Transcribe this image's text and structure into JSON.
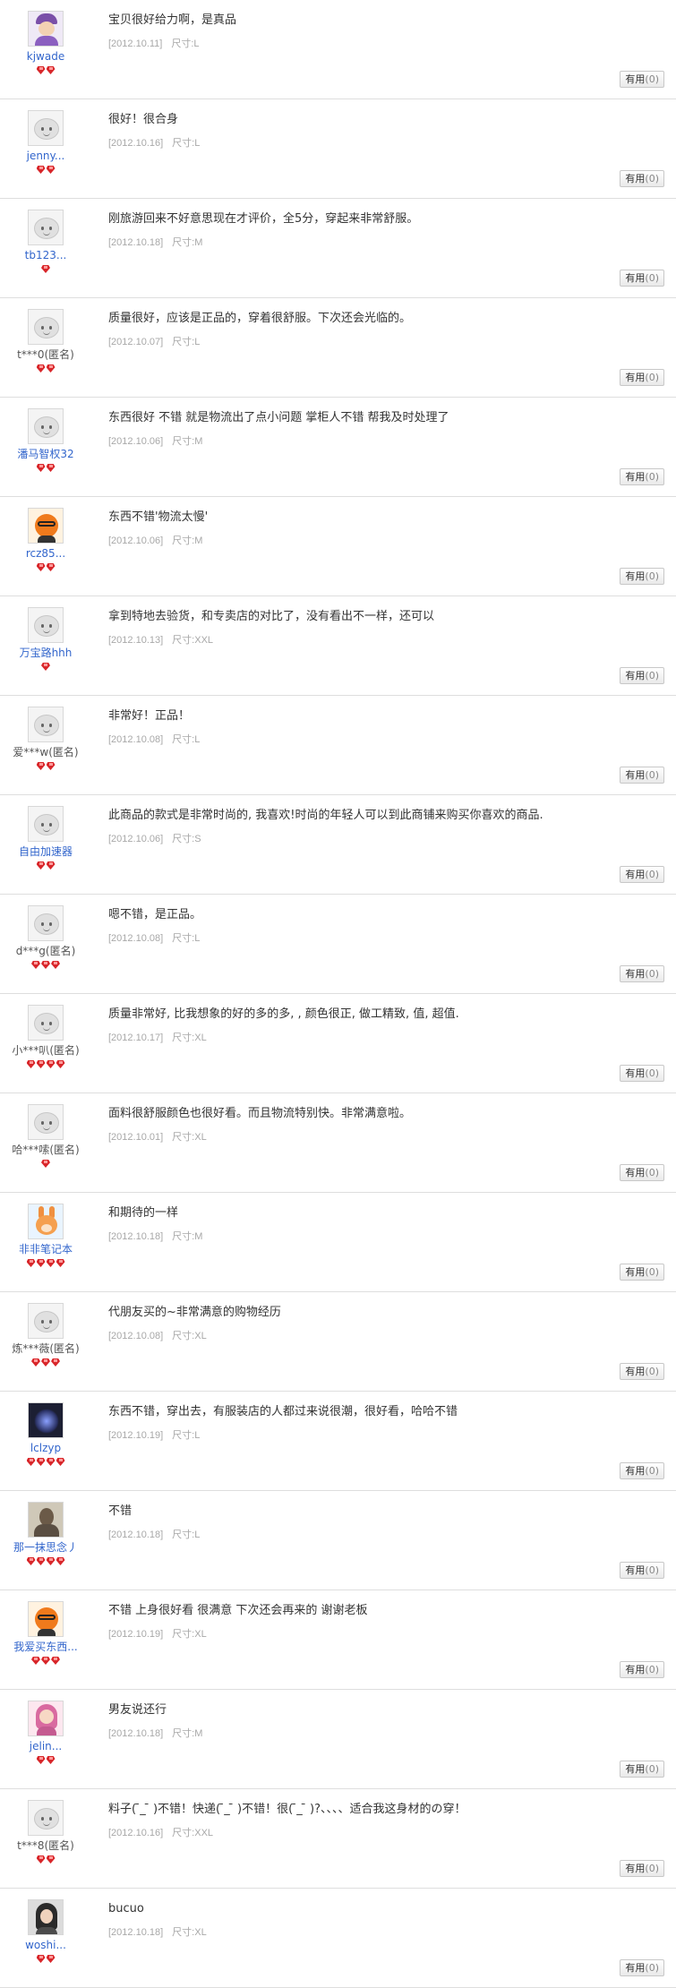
{
  "useful_label": "有用",
  "reviews": [
    {
      "user": "kjwade",
      "name_style": "link",
      "avatar": "purple-hair-avatar",
      "stars": 2,
      "text": "宝贝很好给力啊，是真品",
      "date": "[2012.10.11]",
      "spec": "尺寸:L",
      "useful": "(0)"
    },
    {
      "user": "jenny...",
      "name_style": "link",
      "avatar": "default-avatar",
      "stars": 2,
      "text": "很好！很合身",
      "date": "[2012.10.16]",
      "spec": "尺寸:L",
      "useful": "(0)"
    },
    {
      "user": "tb123...",
      "name_style": "link",
      "avatar": "default-avatar",
      "stars": 1,
      "text": "刚旅游回来不好意思现在才评价，全5分，穿起来非常舒服。",
      "date": "[2012.10.18]",
      "spec": "尺寸:M",
      "useful": "(0)"
    },
    {
      "user": "t***0(匿名)",
      "name_style": "anon",
      "avatar": "default-avatar",
      "stars": 2,
      "text": "质量很好，应该是正品的，穿着很舒服。下次还会光临的。",
      "date": "[2012.10.07]",
      "spec": "尺寸:L",
      "useful": "(0)"
    },
    {
      "user": "潘马智权32",
      "name_style": "link",
      "avatar": "default-avatar",
      "stars": 2,
      "text": "东西很好  不错  就是物流出了点小问题  掌柜人不错  帮我及时处理了",
      "date": "[2012.10.06]",
      "spec": "尺寸:M",
      "useful": "(0)"
    },
    {
      "user": "rcz85...",
      "name_style": "link",
      "avatar": "orange-glasses-avatar",
      "stars": 2,
      "text": "东西不错'物流太慢'",
      "date": "[2012.10.06]",
      "spec": "尺寸:M",
      "useful": "(0)"
    },
    {
      "user": "万宝路hhh",
      "name_style": "link",
      "avatar": "default-avatar",
      "stars": 1,
      "text": "拿到特地去验货，和专卖店的对比了，没有看出不一样，还可以",
      "date": "[2012.10.13]",
      "spec": "尺寸:XXL",
      "useful": "(0)"
    },
    {
      "user": "爱***w(匿名)",
      "name_style": "anon",
      "avatar": "default-avatar",
      "stars": 2,
      "text": "非常好！正品！",
      "date": "[2012.10.08]",
      "spec": "尺寸:L",
      "useful": "(0)"
    },
    {
      "user": "自由加速器",
      "name_style": "link",
      "avatar": "default-avatar",
      "stars": 2,
      "text": "此商品的款式是非常时尚的, 我喜欢!时尚的年轻人可以到此商铺来购买你喜欢的商品.",
      "date": "[2012.10.06]",
      "spec": "尺寸:S",
      "useful": "(0)"
    },
    {
      "user": "d***g(匿名)",
      "name_style": "anon",
      "avatar": "default-avatar",
      "stars": 3,
      "text": "嗯不错，是正品。",
      "date": "[2012.10.08]",
      "spec": "尺寸:L",
      "useful": "(0)"
    },
    {
      "user": "小***叭(匿名)",
      "name_style": "anon",
      "avatar": "default-avatar",
      "stars": 4,
      "text": "质量非常好, 比我想象的好的多的多, , 颜色很正, 做工精致, 值, 超值.",
      "date": "[2012.10.17]",
      "spec": "尺寸:XL",
      "useful": "(0)"
    },
    {
      "user": "哈***嗦(匿名)",
      "name_style": "anon",
      "avatar": "default-avatar",
      "stars": 1,
      "text": "面料很舒服颜色也很好看。而且物流特别快。非常满意啦。",
      "date": "[2012.10.01]",
      "spec": "尺寸:XL",
      "useful": "(0)"
    },
    {
      "user": "非非笔记本",
      "name_style": "link",
      "avatar": "bunny-avatar",
      "stars": 4,
      "text": "和期待的一样",
      "date": "[2012.10.18]",
      "spec": "尺寸:M",
      "useful": "(0)"
    },
    {
      "user": "炼***薇(匿名)",
      "name_style": "anon",
      "avatar": "default-avatar",
      "stars": 3,
      "text": "代朋友买的~非常满意的购物经历",
      "date": "[2012.10.08]",
      "spec": "尺寸:XL",
      "useful": "(0)"
    },
    {
      "user": "lclzyp",
      "name_style": "link",
      "avatar": "dark-photo-avatar",
      "stars": 4,
      "text": "东西不错，穿出去，有服装店的人都过来说很潮，很好看，哈哈不错",
      "date": "[2012.10.19]",
      "spec": "尺寸:L",
      "useful": "(0)"
    },
    {
      "user": "那一抹思念丿",
      "name_style": "link",
      "avatar": "portrait-avatar",
      "stars": 4,
      "text": "不错",
      "date": "[2012.10.18]",
      "spec": "尺寸:L",
      "useful": "(0)"
    },
    {
      "user": "我爱买东西...",
      "name_style": "link",
      "avatar": "orange-glasses-avatar",
      "stars": 3,
      "text": "不错  上身很好看  很满意  下次还会再来的  谢谢老板",
      "date": "[2012.10.19]",
      "spec": "尺寸:XL",
      "useful": "(0)"
    },
    {
      "user": "jelin...",
      "name_style": "link",
      "avatar": "pink-girl-avatar",
      "stars": 2,
      "text": "男友说还行",
      "date": "[2012.10.18]",
      "spec": "尺寸:M",
      "useful": "(0)"
    },
    {
      "user": "t***8(匿名)",
      "name_style": "anon",
      "avatar": "default-avatar",
      "stars": 2,
      "text": "料子(  ̄_ ̄  )不错！快递(  ̄_ ̄  )不错！很(  ̄_ ̄  )?、、、、适合我这身材的の穿！",
      "date": "[2012.10.16]",
      "spec": "尺寸:XXL",
      "useful": "(0)"
    },
    {
      "user": "woshi...",
      "name_style": "link",
      "avatar": "photo-girl-avatar",
      "stars": 2,
      "text": "bucuo",
      "date": "[2012.10.18]",
      "spec": "尺寸:XL",
      "useful": "(0)"
    }
  ]
}
